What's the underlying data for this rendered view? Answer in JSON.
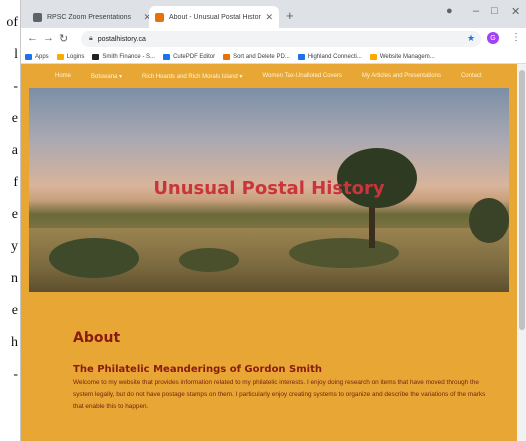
{
  "left_strip": [
    "of",
    "l",
    "-",
    "e",
    "a",
    "f",
    "e",
    "y",
    "n",
    "e",
    "h",
    "-"
  ],
  "tabs": [
    {
      "title": "RPSC Zoom Presentations",
      "fav_color": "#5f6368"
    },
    {
      "title": "About - Unusual Postal History",
      "fav_color": "#e8710a"
    }
  ],
  "new_tab": "+",
  "window_controls": {
    "minimize": "–",
    "maximize": "□",
    "close": "✕"
  },
  "omnibox": {
    "url": "postalhistory.ca"
  },
  "profile_initial": "G",
  "bookmarks": [
    {
      "label": "Apps",
      "color": "#1a73e8"
    },
    {
      "label": "Logins",
      "color": "#f9ab00"
    },
    {
      "label": "Smith Finance - S...",
      "color": "#202124"
    },
    {
      "label": "CutePDF Editor",
      "color": "#1a73e8"
    },
    {
      "label": "Sort and Delete PD...",
      "color": "#e8710a"
    },
    {
      "label": "Highland Connecti...",
      "color": "#1a73e8"
    },
    {
      "label": "Website Managem...",
      "color": "#f9ab00"
    }
  ],
  "site_nav": [
    "Home",
    "Botswana ▾",
    "Rich Hoards and Rich Morals Island ▾",
    "Women Tax-Unalloted Covers",
    "My Articles and Presentations",
    "Contact"
  ],
  "hero_title": "Unusual Postal History",
  "about_heading": "About",
  "sub_heading": "The Philatelic Meanderings of Gordon Smith",
  "body_text": "Welcome to my website that provides information related to my philatelic interests. I enjoy doing research on items that have moved through the system legally, but do not have postage stamps on them. I particularly enjoy creating systems to organize and describe the variations of the marks that enable this to happen."
}
